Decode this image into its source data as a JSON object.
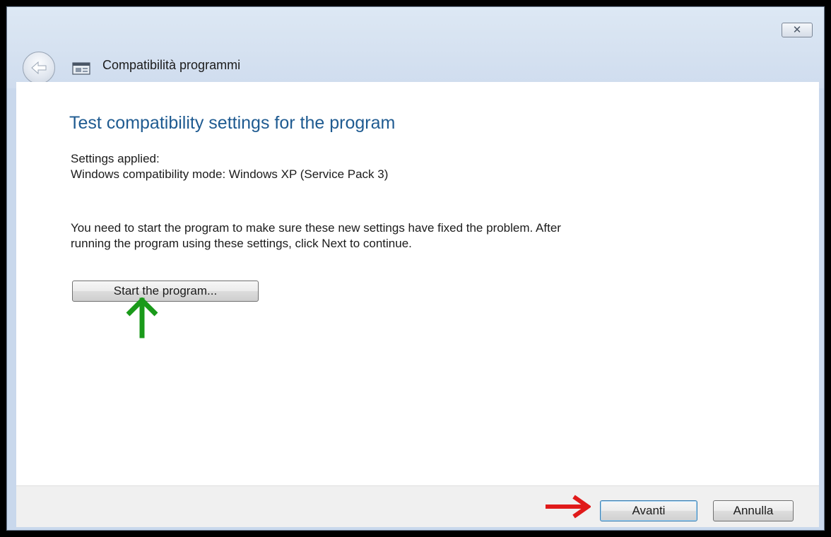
{
  "window": {
    "title": "Compatibilità programmi",
    "close_symbol": "✕",
    "icons": [
      "back-arrow-icon",
      "app-window-icon",
      "close-icon"
    ]
  },
  "main": {
    "heading": "Test compatibility settings for the program",
    "settings_label": "Settings applied:",
    "settings_value": "Windows compatibility mode: Windows XP (Service Pack 3)",
    "instruction_line1": "You need to start the program to make sure these new settings have fixed the problem. After",
    "instruction_line2": "running the program using these settings, click Next to continue.",
    "start_button": "Start the program..."
  },
  "footer": {
    "next_button": "Avanti",
    "cancel_button": "Annulla"
  },
  "annotations": [
    {
      "name": "green-up-arrow",
      "color": "#1a9a1a",
      "points_to": "start-program-button"
    },
    {
      "name": "red-right-arrow",
      "color": "#e01a1a",
      "points_to": "next-button"
    }
  ]
}
